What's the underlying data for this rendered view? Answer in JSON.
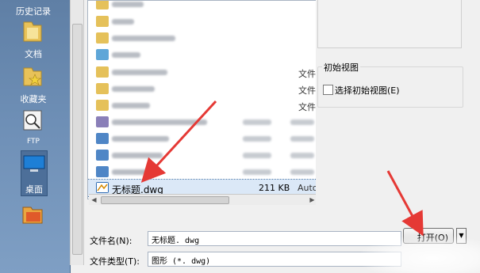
{
  "sidebar": {
    "items": [
      {
        "label": "历史记录",
        "icon": "history-icon"
      },
      {
        "label": "文档",
        "icon": "documents-folder-icon"
      },
      {
        "label": "收藏夹",
        "icon": "favorites-folder-icon"
      },
      {
        "label": "FTP",
        "icon": "ftp-icon"
      },
      {
        "label": "桌面",
        "icon": "desktop-icon"
      },
      {
        "label": "",
        "icon": "buzzsaw-folder-icon"
      }
    ]
  },
  "file_list": {
    "type_column": [
      "文件",
      "文件",
      "文件"
    ],
    "selected_file": {
      "name": "无标题.dwg",
      "size": "211 KB",
      "type": "Auto"
    }
  },
  "right_panel": {
    "initial_view_title": "初始视图",
    "select_initial_view_label": "选择初始视图(E)"
  },
  "bottom": {
    "filename_label": "文件名(N):",
    "filename_value": "无标题. dwg",
    "filetype_label": "文件类型(T):",
    "filetype_value": "图形 (*. dwg)",
    "open_button_label": "打开(O)"
  },
  "colors": {
    "arrow": "#e53935",
    "selection": "#dbe8f7",
    "sidebar": "#6e8fb6"
  }
}
